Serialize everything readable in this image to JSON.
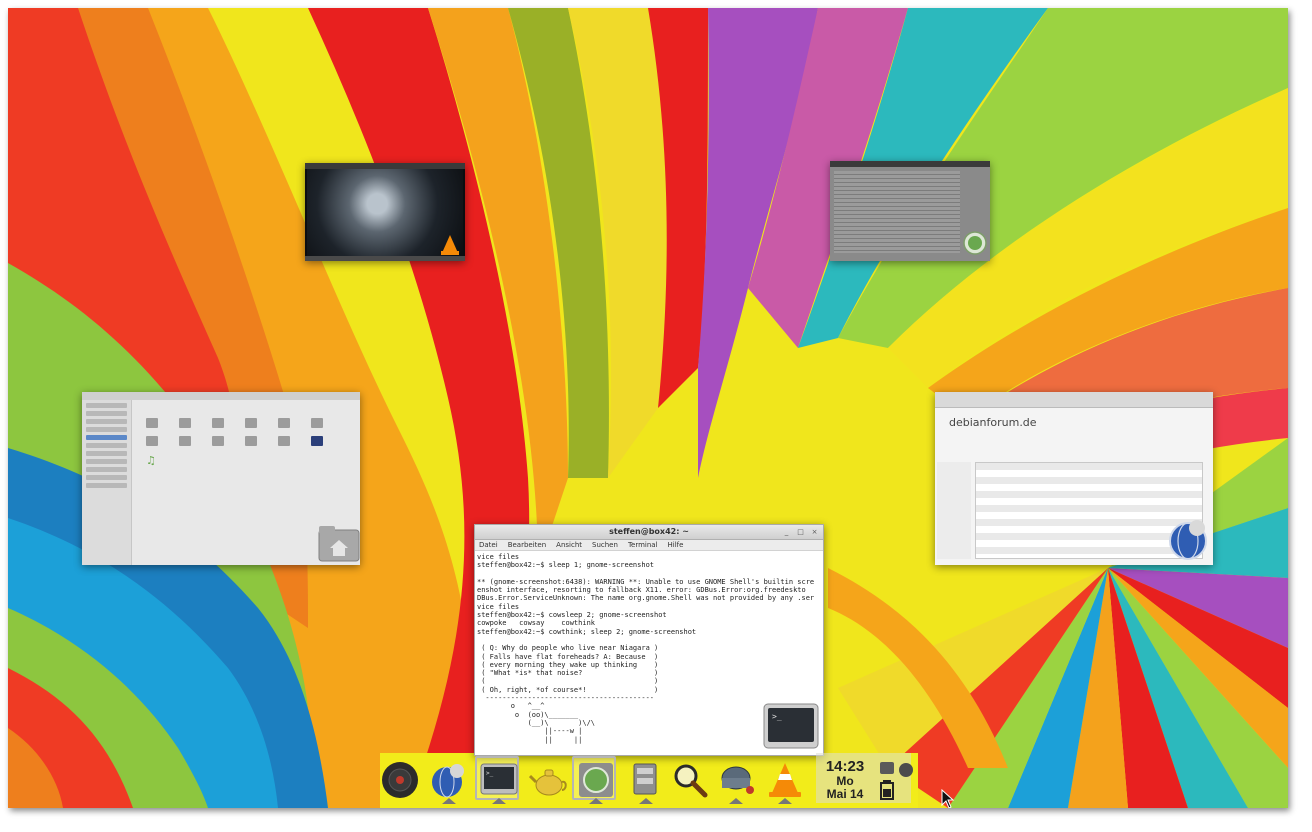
{
  "desktop": {
    "windows": {
      "video": {
        "name": "video player"
      },
      "torrent": {
        "name": "torrent client"
      },
      "files": {
        "name": "file manager"
      },
      "browser": {
        "name": "web browser",
        "logo_text": "debianforum.de"
      },
      "terminal": {
        "title": "steffen@box42: ~",
        "menu": [
          "Datei",
          "Bearbeiten",
          "Ansicht",
          "Suchen",
          "Terminal",
          "Hilfe"
        ],
        "output": "vice files\nsteffen@box42:~$ sleep 1; gnome-screenshot\n\n** (gnome-screenshot:6438): WARNING **: Unable to use GNOME Shell's builtin scre\nenshot interface, resorting to fallback X11. error: GDBus.Error:org.freedeskto\nDBus.Error.ServiceUnknown: The name org.gnome.Shell was not provided by any .ser\nvice files\nsteffen@box42:~$ cowsleep 2; gnome-screenshot\ncowpoke   cowsay    cowthink\nsteffen@box42:~$ cowthink; sleep 2; gnome-screenshot\n\n ( Q: Why do people who live near Niagara )\n ( Falls have flat foreheads? A: Because  )\n ( every morning they wake up thinking    )\n ( \"What *is* that noise?                 )\n (                                        )\n ( Oh, right, *of course*!                )\n  ----------------------------------------\n        o   ^__^\n         o  (oo)\\_______\n            (__)\\       )\\/\\\n                ||----w |\n                ||     ||"
      }
    }
  },
  "dock": {
    "items": [
      {
        "name": "music-player-icon",
        "label": "music player"
      },
      {
        "name": "browser-icon",
        "label": "web browser"
      },
      {
        "name": "terminal-icon",
        "label": "terminal"
      },
      {
        "name": "teapot-icon",
        "label": "teapot app"
      },
      {
        "name": "torrent-icon",
        "label": "torrent client"
      },
      {
        "name": "file-manager-icon",
        "label": "file manager"
      },
      {
        "name": "search-icon",
        "label": "search"
      },
      {
        "name": "screenshot-icon",
        "label": "screenshot"
      },
      {
        "name": "vlc-icon",
        "label": "vlc"
      }
    ],
    "clock": {
      "time": "14:23",
      "weekday": "Mo",
      "date": "Mai 14"
    }
  },
  "colors": {
    "dock_background": "#f2ec1a",
    "accent_orange": "#f58a07",
    "selection_blue": "#5b88c8"
  }
}
